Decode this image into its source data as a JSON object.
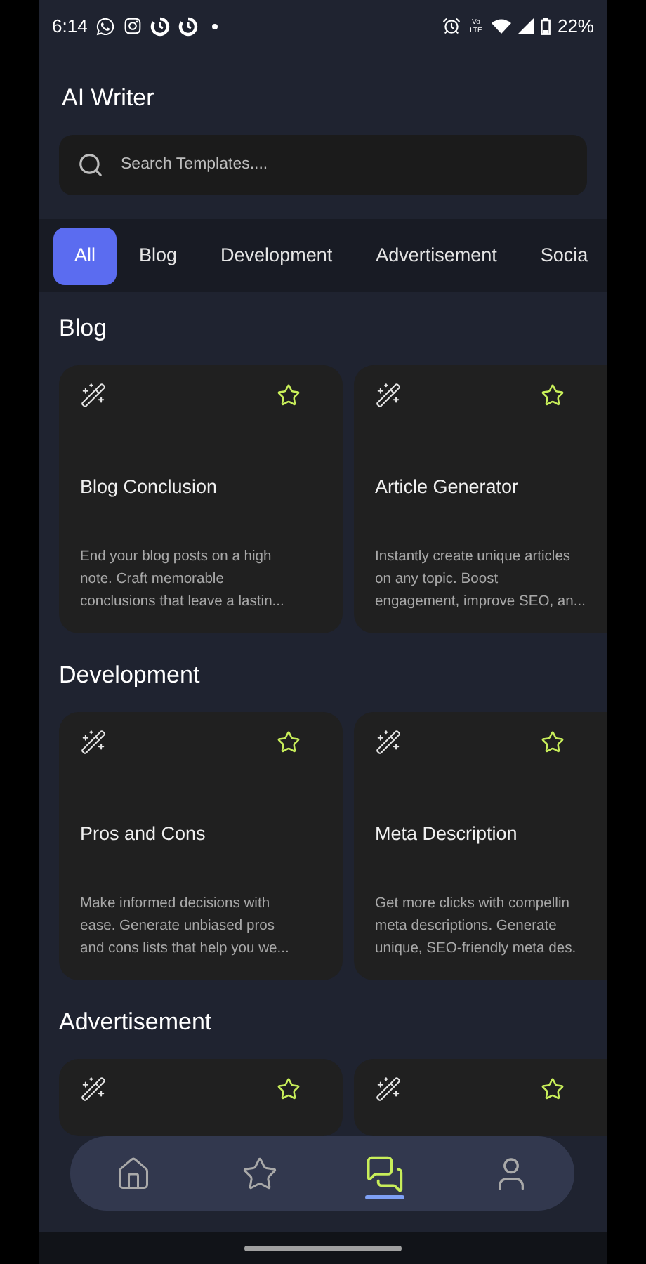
{
  "status_bar": {
    "time": "6:14",
    "network": "Vo LTE",
    "battery": "22%"
  },
  "header": {
    "title": "AI Writer"
  },
  "search": {
    "placeholder": "Search Templates...."
  },
  "tabs": [
    {
      "label": "All",
      "selected": true
    },
    {
      "label": "Blog",
      "selected": false
    },
    {
      "label": "Development",
      "selected": false
    },
    {
      "label": "Advertisement",
      "selected": false
    },
    {
      "label": "Socia",
      "selected": false
    }
  ],
  "sections": [
    {
      "title": "Blog",
      "cards": [
        {
          "title": "Blog Conclusion",
          "description": "End your blog posts on a high\nnote. Craft memorable\nconclusions that leave a lastin..."
        },
        {
          "title": "Article Generator",
          "description": "Instantly create unique articles\non any topic. Boost\nengagement, improve SEO, an..."
        }
      ]
    },
    {
      "title": "Development",
      "cards": [
        {
          "title": "Pros and Cons",
          "description": "Make informed decisions with\nease. Generate unbiased pros\nand cons lists that help you we..."
        },
        {
          "title": "Meta Description",
          "description": "Get more clicks with compellin\nmeta descriptions. Generate\nunique, SEO-friendly meta des."
        }
      ]
    },
    {
      "title": "Advertisement",
      "cards": [
        {
          "kind": "covered"
        },
        {
          "kind": "covered"
        }
      ]
    }
  ],
  "bottom_nav": [
    {
      "kind": "home",
      "selected": false
    },
    {
      "kind": "favorites",
      "selected": false
    },
    {
      "kind": "chat",
      "selected": true
    },
    {
      "kind": "profile",
      "selected": false
    }
  ]
}
